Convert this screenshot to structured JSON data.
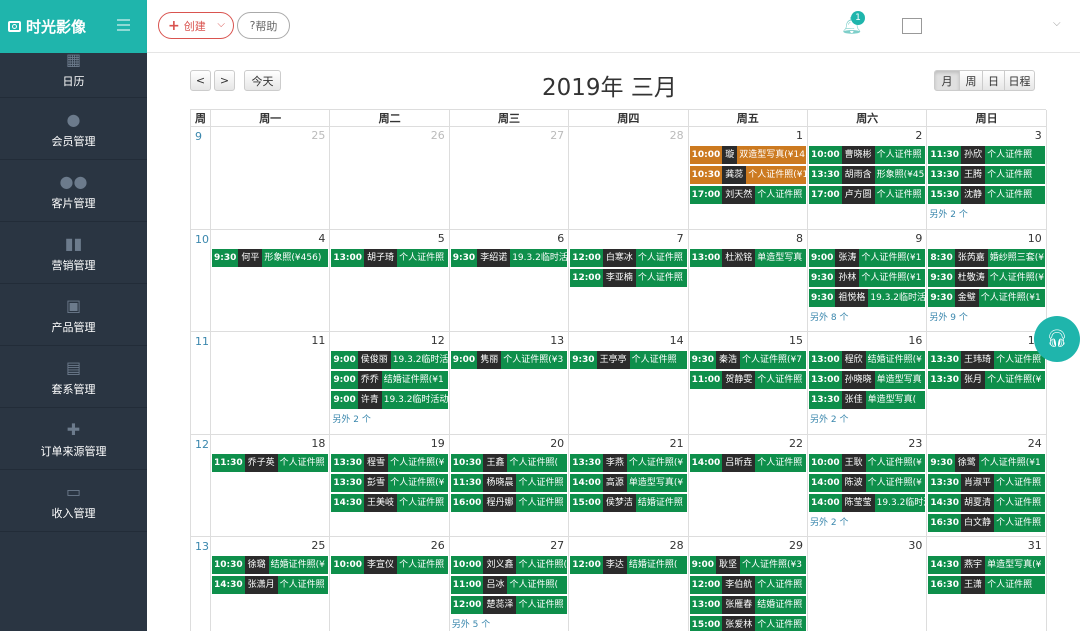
{
  "app": {
    "name": "时光影像"
  },
  "sidebar": {
    "items": [
      {
        "label": "日历",
        "icon": "calendar-icon"
      },
      {
        "label": "会员管理",
        "icon": "user-icon"
      },
      {
        "label": "客片管理",
        "icon": "users-icon"
      },
      {
        "label": "营销管理",
        "icon": "bar-chart-icon"
      },
      {
        "label": "产品管理",
        "icon": "product-icon"
      },
      {
        "label": "套系管理",
        "icon": "id-card-icon"
      },
      {
        "label": "订单来源管理",
        "icon": "puzzle-icon"
      },
      {
        "label": "收入管理",
        "icon": "money-icon"
      }
    ]
  },
  "topbar": {
    "create_label": "创建",
    "help_label": "帮助",
    "notification_count": "1"
  },
  "toolbar": {
    "prev": "<",
    "next": ">",
    "today": "今天",
    "title": "2019年 三月",
    "views": [
      "月",
      "周",
      "日",
      "日程"
    ],
    "active_view": "月"
  },
  "calendar": {
    "headers": [
      "周",
      "周一",
      "周二",
      "周三",
      "周四",
      "周五",
      "周六",
      "周日"
    ],
    "weeks": [
      {
        "week": "9",
        "days": [
          {
            "date": "25",
            "other": true,
            "events": []
          },
          {
            "date": "26",
            "other": true,
            "events": []
          },
          {
            "date": "27",
            "other": true,
            "events": []
          },
          {
            "date": "28",
            "other": true,
            "events": []
          },
          {
            "date": "1",
            "events": [
              {
                "time": "10:00",
                "name": "璇",
                "service": "双造型写真(¥14",
                "color": "o"
              },
              {
                "time": "10:30",
                "name": "龚蕊",
                "service": "个人证件照(¥1",
                "color": "o"
              },
              {
                "time": "17:00",
                "name": "刘天然",
                "service": "个人证件照",
                "color": "g"
              }
            ]
          },
          {
            "date": "2",
            "events": [
              {
                "time": "10:00",
                "name": "曹晓彬",
                "service": "个人证件照",
                "color": "g"
              },
              {
                "time": "13:30",
                "name": "胡雨含",
                "service": "形象照(¥45",
                "color": "g"
              },
              {
                "time": "17:00",
                "name": "卢方圆",
                "service": "个人证件照",
                "color": "g"
              }
            ]
          },
          {
            "date": "3",
            "more": "另外 2 个",
            "events": [
              {
                "time": "11:30",
                "name": "孙欣",
                "service": "个人证件照",
                "color": "g"
              },
              {
                "time": "13:30",
                "name": "王腾",
                "service": "个人证件照",
                "color": "g"
              },
              {
                "time": "15:30",
                "name": "沈静",
                "service": "个人证件照",
                "color": "g"
              }
            ]
          }
        ]
      },
      {
        "week": "10",
        "days": [
          {
            "date": "4",
            "events": [
              {
                "time": "9:30",
                "name": "何平",
                "service": "形象照(¥456)",
                "color": "g"
              }
            ]
          },
          {
            "date": "5",
            "events": [
              {
                "time": "13:00",
                "name": "胡子琦",
                "service": "个人证件照",
                "color": "g"
              }
            ]
          },
          {
            "date": "6",
            "events": [
              {
                "time": "9:30",
                "name": "李绍诺",
                "service": "19.3.2临时活",
                "color": "g"
              }
            ]
          },
          {
            "date": "7",
            "events": [
              {
                "time": "12:00",
                "name": "白寒冰",
                "service": "个人证件照",
                "color": "g"
              },
              {
                "time": "12:00",
                "name": "李亚楠",
                "service": "个人证件照",
                "color": "g"
              }
            ]
          },
          {
            "date": "8",
            "events": [
              {
                "time": "13:00",
                "name": "杜淞铭",
                "service": "单造型写真",
                "color": "g"
              }
            ]
          },
          {
            "date": "9",
            "more": "另外 8 个",
            "events": [
              {
                "time": "9:00",
                "name": "张涛",
                "service": "个人证件照(¥1",
                "color": "g"
              },
              {
                "time": "9:30",
                "name": "孙林",
                "service": "个人证件照(¥1",
                "color": "g"
              },
              {
                "time": "9:30",
                "name": "祖悦格",
                "service": "19.3.2临时活",
                "color": "g"
              }
            ]
          },
          {
            "date": "10",
            "more": "另外 9 个",
            "events": [
              {
                "time": "8:30",
                "name": "张芮嘉",
                "service": "婚纱照三套(¥",
                "color": "g"
              },
              {
                "time": "9:30",
                "name": "杜敬涛",
                "service": "个人证件照(¥",
                "color": "g"
              },
              {
                "time": "9:30",
                "name": "金璧",
                "service": "个人证件照(¥1",
                "color": "g"
              }
            ]
          }
        ]
      },
      {
        "week": "11",
        "days": [
          {
            "date": "11",
            "events": []
          },
          {
            "date": "12",
            "more": "另外 2 个",
            "events": [
              {
                "time": "9:00",
                "name": "侯俊丽",
                "service": "19.3.2临时活",
                "color": "g"
              },
              {
                "time": "9:00",
                "name": "乔乔",
                "service": "结婚证件照(¥1",
                "color": "g"
              },
              {
                "time": "9:00",
                "name": "许青",
                "service": "19.3.2临时活动",
                "color": "g"
              }
            ]
          },
          {
            "date": "13",
            "events": [
              {
                "time": "9:00",
                "name": "隽丽",
                "service": "个人证件照(¥3",
                "color": "g"
              }
            ]
          },
          {
            "date": "14",
            "events": [
              {
                "time": "9:30",
                "name": "王亭亭",
                "service": "个人证件照",
                "color": "g"
              }
            ]
          },
          {
            "date": "15",
            "events": [
              {
                "time": "9:30",
                "name": "秦浩",
                "service": "个人证件照(¥7",
                "color": "g"
              },
              {
                "time": "11:00",
                "name": "贺静雯",
                "service": "个人证件照",
                "color": "g"
              }
            ]
          },
          {
            "date": "16",
            "more": "另外 2 个",
            "events": [
              {
                "time": "13:00",
                "name": "程欣",
                "service": "结婚证件照(¥",
                "color": "g"
              },
              {
                "time": "13:00",
                "name": "孙晓晓",
                "service": "单造型写真",
                "color": "g"
              },
              {
                "time": "13:30",
                "name": "张佳",
                "service": "单造型写真(",
                "color": "g"
              }
            ]
          },
          {
            "date": "17",
            "events": [
              {
                "time": "13:30",
                "name": "王玮琦",
                "service": "个人证件照",
                "color": "g"
              },
              {
                "time": "13:30",
                "name": "张月",
                "service": "个人证件照(¥",
                "color": "g"
              }
            ]
          }
        ]
      },
      {
        "week": "12",
        "days": [
          {
            "date": "18",
            "events": [
              {
                "time": "11:30",
                "name": "乔子英",
                "service": "个人证件照",
                "color": "g"
              }
            ]
          },
          {
            "date": "19",
            "events": [
              {
                "time": "13:30",
                "name": "程雪",
                "service": "个人证件照(¥",
                "color": "g"
              },
              {
                "time": "13:30",
                "name": "彭雪",
                "service": "个人证件照(¥",
                "color": "g"
              },
              {
                "time": "14:30",
                "name": "王美岐",
                "service": "个人证件照",
                "color": "g"
              }
            ]
          },
          {
            "date": "20",
            "events": [
              {
                "time": "10:30",
                "name": "王鑫",
                "service": "个人证件照(",
                "color": "g"
              },
              {
                "time": "11:30",
                "name": "杨晓晨",
                "service": "个人证件照",
                "color": "g"
              },
              {
                "time": "16:00",
                "name": "程丹娜",
                "service": "个人证件照",
                "color": "g"
              }
            ]
          },
          {
            "date": "21",
            "events": [
              {
                "time": "13:30",
                "name": "李燕",
                "service": "个人证件照(¥",
                "color": "g"
              },
              {
                "time": "14:00",
                "name": "高源",
                "service": "单造型写真(¥",
                "color": "g"
              },
              {
                "time": "15:00",
                "name": "侯梦洁",
                "service": "结婚证件照",
                "color": "g"
              }
            ]
          },
          {
            "date": "22",
            "events": [
              {
                "time": "14:00",
                "name": "吕昕垚",
                "service": "个人证件照",
                "color": "g"
              }
            ]
          },
          {
            "date": "23",
            "more": "另外 2 个",
            "events": [
              {
                "time": "10:00",
                "name": "王耿",
                "service": "个人证件照(¥",
                "color": "g"
              },
              {
                "time": "14:00",
                "name": "陈波",
                "service": "个人证件照(¥",
                "color": "g"
              },
              {
                "time": "14:00",
                "name": "陈莹莹",
                "service": "19.3.2临时活",
                "color": "g"
              }
            ]
          },
          {
            "date": "24",
            "events": [
              {
                "time": "9:30",
                "name": "徐鹭",
                "service": "个人证件照(¥1",
                "color": "g"
              },
              {
                "time": "13:30",
                "name": "肖淑平",
                "service": "个人证件照",
                "color": "g"
              },
              {
                "time": "14:30",
                "name": "胡夏清",
                "service": "个人证件照",
                "color": "g"
              },
              {
                "time": "16:30",
                "name": "白文静",
                "service": "个人证件照",
                "color": "g"
              }
            ]
          }
        ]
      },
      {
        "week": "13",
        "days": [
          {
            "date": "25",
            "events": [
              {
                "time": "10:30",
                "name": "徐璐",
                "service": "结婚证件照(¥",
                "color": "g"
              },
              {
                "time": "14:30",
                "name": "张潇月",
                "service": "个人证件照",
                "color": "g"
              }
            ]
          },
          {
            "date": "26",
            "events": [
              {
                "time": "10:00",
                "name": "李宣仪",
                "service": "个人证件照",
                "color": "g"
              }
            ]
          },
          {
            "date": "27",
            "more": "另外 5 个",
            "events": [
              {
                "time": "10:00",
                "name": "刘义鑫",
                "service": "个人证件照(",
                "color": "g"
              },
              {
                "time": "11:00",
                "name": "吕冰",
                "service": "个人证件照(",
                "color": "g"
              },
              {
                "time": "12:00",
                "name": "楚蕊泽",
                "service": "个人证件照",
                "color": "g"
              }
            ]
          },
          {
            "date": "28",
            "events": [
              {
                "time": "12:00",
                "name": "李达",
                "service": "结婚证件照(",
                "color": "g"
              }
            ]
          },
          {
            "date": "29",
            "events": [
              {
                "time": "9:00",
                "name": "耿坚",
                "service": "个人证件照(¥3",
                "color": "g"
              },
              {
                "time": "12:00",
                "name": "李伯航",
                "service": "个人证件照",
                "color": "g"
              },
              {
                "time": "13:00",
                "name": "张雁春",
                "service": "结婚证件照",
                "color": "g"
              },
              {
                "time": "15:00",
                "name": "张爱林",
                "service": "个人证件照",
                "color": "g"
              }
            ]
          },
          {
            "date": "30",
            "events": []
          },
          {
            "date": "31",
            "events": [
              {
                "time": "14:30",
                "name": "燕宇",
                "service": "单造型写真(¥",
                "color": "g"
              },
              {
                "time": "16:30",
                "name": "王潇",
                "service": "个人证件照",
                "color": "g"
              }
            ]
          }
        ]
      }
    ]
  }
}
